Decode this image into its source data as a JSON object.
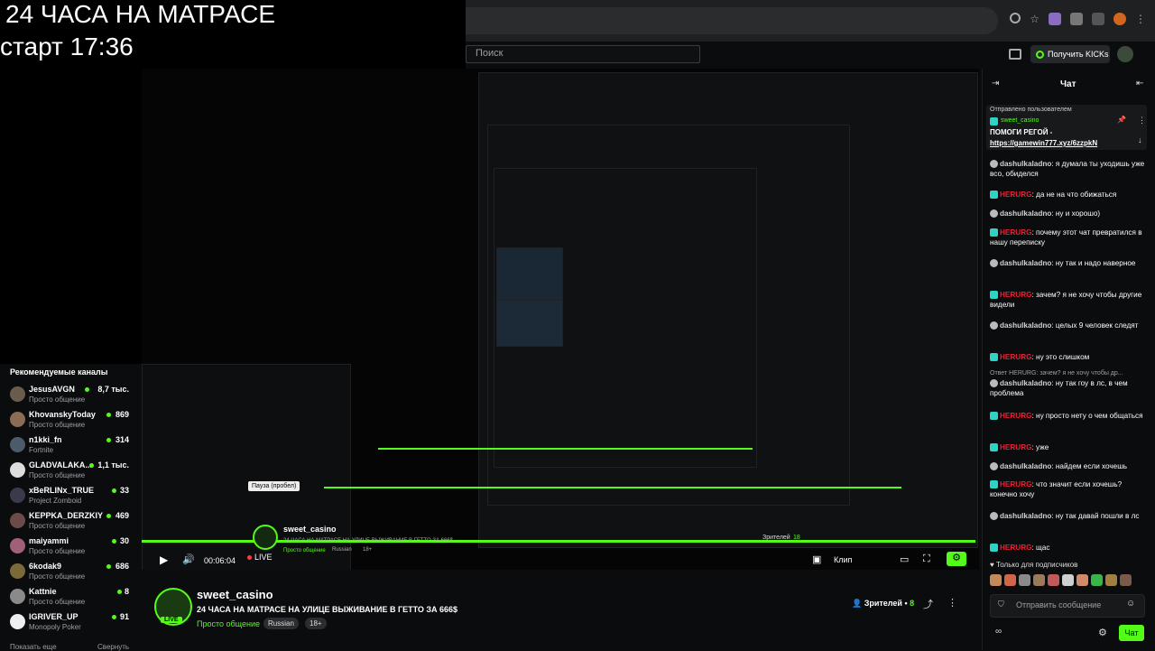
{
  "overlay": {
    "line1": "24 ЧАСА НА МАТРАСЕ",
    "line2": "старт 17:36"
  },
  "header": {
    "search_placeholder": "Поиск",
    "get_kicks": "Получить KICKs"
  },
  "sidebar": {
    "title": "Рекомендуемые каналы",
    "channels": [
      {
        "name": "JesusAVGN",
        "category": "Просто общение",
        "viewers": "8,7 тыс."
      },
      {
        "name": "KhovanskyToday",
        "category": "Просто общение",
        "viewers": "869"
      },
      {
        "name": "n1kki_fn",
        "category": "Fortnite",
        "viewers": "314"
      },
      {
        "name": "GLADVALAKA...",
        "category": "Просто общение",
        "viewers": "1,1 тыс."
      },
      {
        "name": "xBeRLINx_TRUE",
        "category": "Project Zomboid",
        "viewers": "33"
      },
      {
        "name": "KEPPKA_DERZKIY",
        "category": "Просто общение",
        "viewers": "469"
      },
      {
        "name": "maiyammi",
        "category": "Просто общение",
        "viewers": "30"
      },
      {
        "name": "6kodak9",
        "category": "Просто общение",
        "viewers": "686"
      },
      {
        "name": "Kattnie",
        "category": "Просто общение",
        "viewers": "8"
      },
      {
        "name": "IGRIVER_UP",
        "category": "Monopoly Poker",
        "viewers": "91"
      }
    ],
    "show_more": "Показать еще",
    "collapse": "Свернуть"
  },
  "player": {
    "time": "00:06:04",
    "live": "LIVE",
    "tooltip": "Пауза (пробел)",
    "embedded_name": "sweet_casino",
    "embedded_title": "24 ЧАСА НА МАТРАСЕ НА УЛИЦЕ ВЫЖИВАНИЕ В ГЕТТО ЗА 666$",
    "embedded_category": "Просто общение",
    "embedded_tags": [
      "Russian",
      "18+"
    ],
    "embedded_viewers_label": "Зрителей",
    "embedded_viewers": "18",
    "clip_label": "Клип"
  },
  "stream": {
    "channel": "sweet_casino",
    "title": "24 ЧАСА НА МАТРАСЕ НА УЛИЦЕ ВЫЖИВАНИЕ В ГЕТТО ЗА 666$",
    "category": "Просто общение",
    "tags": [
      "Russian",
      "18+"
    ],
    "viewers_label": "Зрителей",
    "viewers": "8",
    "live_badge": "LIVE"
  },
  "chat": {
    "title": "Чат",
    "pinned": {
      "label": "Отправлено пользователем",
      "user": "sweet_casino",
      "text": "ПОМОГИ РЕГОЙ -",
      "link": "https://gamewin777.xyz/6zzpkN"
    },
    "messages": [
      {
        "user": "dashulkaladno",
        "color": "gray",
        "text": "я думала ты уходишь уже всо, обиделся"
      },
      {
        "user": "HERURG",
        "color": "red",
        "text": "да не на что обижаться"
      },
      {
        "user": "dashulkaladno",
        "color": "gray",
        "text": "ну и хорошо)"
      },
      {
        "user": "HERURG",
        "color": "red",
        "text": "почему этот чат превратился в нашу переписку"
      },
      {
        "user": "dashulkaladno",
        "color": "gray",
        "text": "ну так и надо наверное"
      },
      {
        "user": "HERURG",
        "color": "red",
        "text": "зачем? я не хочу чтобы другие видели"
      },
      {
        "user": "dashulkaladno",
        "color": "gray",
        "text": "целых 9 человек следят"
      },
      {
        "user": "HERURG",
        "color": "red",
        "text": "ну это слишком"
      },
      {
        "reply": "Ответ HERURG: зачем? я не хочу чтобы др...",
        "user": "dashulkaladno",
        "color": "gray",
        "text": "ну так гоу в лс, в чем проблема"
      },
      {
        "user": "HERURG",
        "color": "red",
        "text": "ну просто нету о чем общаться"
      },
      {
        "user": "HERURG",
        "color": "red",
        "text": "уже"
      },
      {
        "user": "dashulkaladno",
        "color": "gray",
        "text": "найдем если хочешь"
      },
      {
        "user": "HERURG",
        "color": "red",
        "text": "что значит если хочешь? конечно хочу"
      },
      {
        "user": "dashulkaladno",
        "color": "gray",
        "text": "ну так давай пошли в лс"
      },
      {
        "user": "HERURG",
        "color": "red",
        "text": "щас"
      }
    ],
    "subs_only": "Только для подписчиков",
    "send_placeholder": "Отправить сообщение",
    "chat_button": "Чат",
    "infinity": "∞"
  }
}
